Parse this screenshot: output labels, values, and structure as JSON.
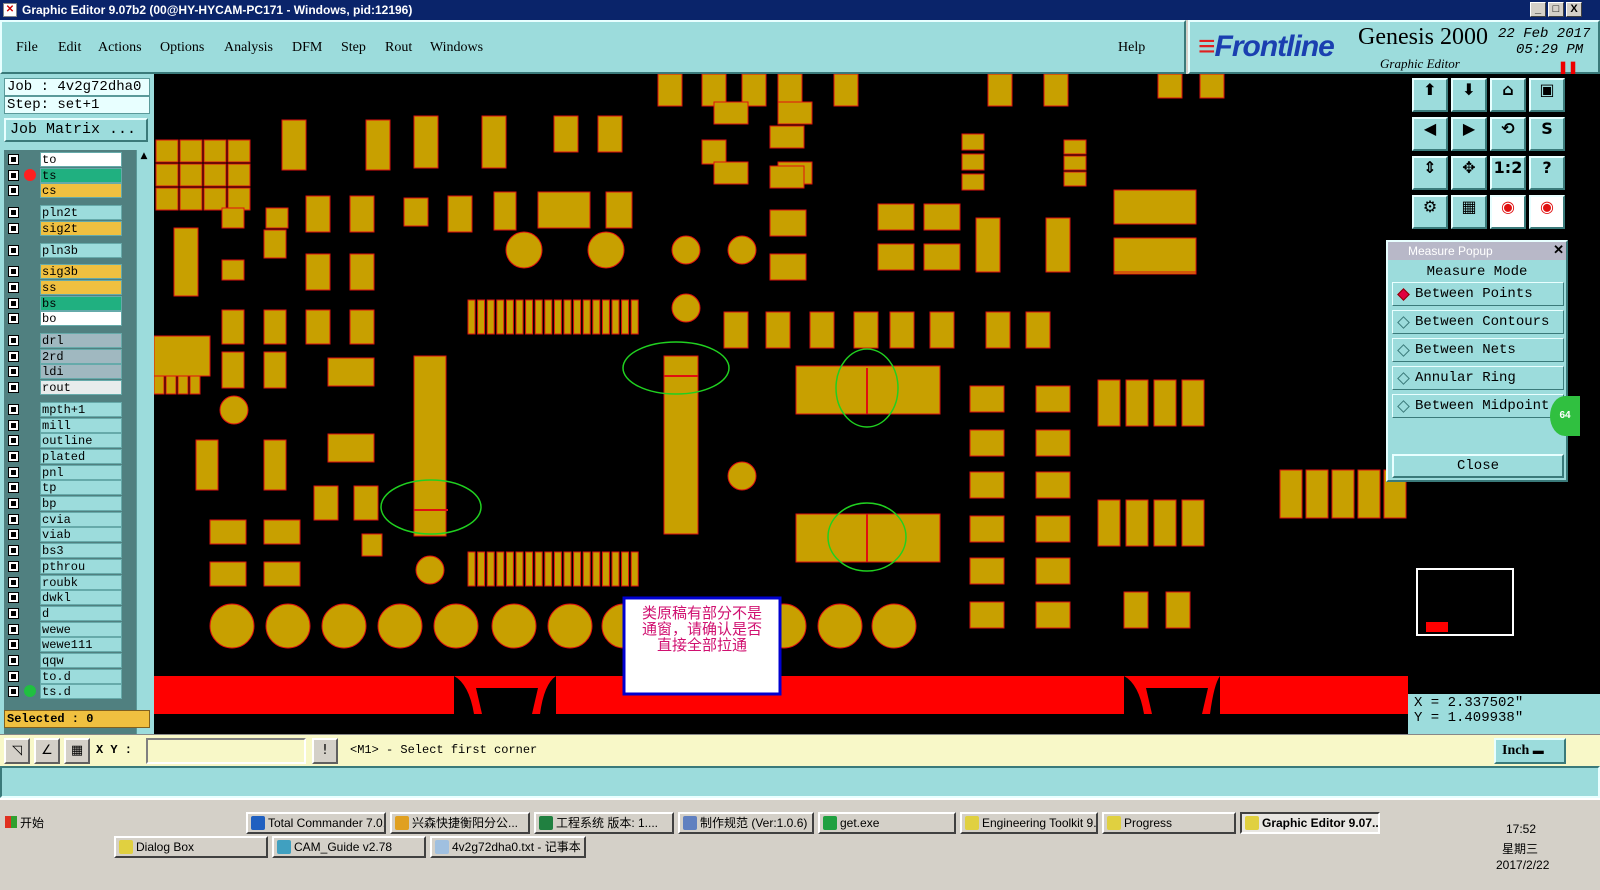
{
  "window": {
    "title": "Graphic Editor 9.07b2 (00@HY-HYCAM-PC171 - Windows, pid:12196)",
    "controls": [
      "_",
      "□",
      "X"
    ]
  },
  "menu": [
    "File",
    "Edit",
    "Actions",
    "Options",
    "Analysis",
    "DFM",
    "Step",
    "Rout",
    "Windows"
  ],
  "help_label": "Help",
  "brand": {
    "logo": "Frontline",
    "product": "Genesis 2000",
    "subtitle": "Graphic Editor",
    "date": "22 Feb 2017",
    "time": "05:29 PM",
    "pause_icon": "pause-icon"
  },
  "job": "Job : 4v2g72dha0",
  "step": "Step: set+1",
  "job_matrix": "Job Matrix ...",
  "layers": [
    {
      "name": "to",
      "color": "#ffffff",
      "dot": ""
    },
    {
      "name": "ts",
      "color": "#20b080",
      "dot": "#ff2020"
    },
    {
      "name": "cs",
      "color": "#f0c040",
      "dot": ""
    },
    {
      "name": "pln2t",
      "color": "#9cdcdc",
      "dot": ""
    },
    {
      "name": "sig2t",
      "color": "#f0c040",
      "dot": ""
    },
    {
      "name": "pln3b",
      "color": "#9cdcdc",
      "dot": ""
    },
    {
      "name": "sig3b",
      "color": "#f0c040",
      "dot": ""
    },
    {
      "name": "ss",
      "color": "#f0c040",
      "dot": ""
    },
    {
      "name": "bs",
      "color": "#20b080",
      "dot": ""
    },
    {
      "name": "bo",
      "color": "#ffffff",
      "dot": ""
    },
    {
      "name": "drl",
      "color": "#a0b8c0",
      "dot": ""
    },
    {
      "name": "2rd",
      "color": "#a0b8c0",
      "dot": ""
    },
    {
      "name": "ldi",
      "color": "#a0b8c0",
      "dot": ""
    },
    {
      "name": "rout",
      "color": "#e8ecec",
      "dot": ""
    },
    {
      "name": "mpth+1",
      "color": "#9cdcdc",
      "dot": ""
    },
    {
      "name": "mill",
      "color": "#9cdcdc",
      "dot": ""
    },
    {
      "name": "outline",
      "color": "#9cdcdc",
      "dot": ""
    },
    {
      "name": "plated",
      "color": "#9cdcdc",
      "dot": ""
    },
    {
      "name": "pnl",
      "color": "#9cdcdc",
      "dot": ""
    },
    {
      "name": "tp",
      "color": "#9cdcdc",
      "dot": ""
    },
    {
      "name": "bp",
      "color": "#9cdcdc",
      "dot": ""
    },
    {
      "name": "cvia",
      "color": "#9cdcdc",
      "dot": ""
    },
    {
      "name": "viab",
      "color": "#9cdcdc",
      "dot": ""
    },
    {
      "name": "bs3",
      "color": "#9cdcdc",
      "dot": ""
    },
    {
      "name": "pthrou",
      "color": "#9cdcdc",
      "dot": ""
    },
    {
      "name": "roubk",
      "color": "#9cdcdc",
      "dot": ""
    },
    {
      "name": "dwkl",
      "color": "#9cdcdc",
      "dot": ""
    },
    {
      "name": "d",
      "color": "#9cdcdc",
      "dot": ""
    },
    {
      "name": "wewe",
      "color": "#9cdcdc",
      "dot": ""
    },
    {
      "name": "wewe111",
      "color": "#9cdcdc",
      "dot": ""
    },
    {
      "name": "qqw",
      "color": "#9cdcdc",
      "dot": ""
    },
    {
      "name": "to.d",
      "color": "#9cdcdc",
      "dot": ""
    },
    {
      "name": "ts.d",
      "color": "#9cdcdc",
      "dot": "#20c040"
    }
  ],
  "selected": "Selected : 0",
  "annotation": {
    "line1": "类原稿有部分不是",
    "line2": "通窗，请确认是否",
    "line3": "直接全部拉通"
  },
  "toolbar_icons": [
    "zoom-home-icon",
    "zoom-in-icon",
    "home-icon",
    "window-icon",
    "pan-left-icon",
    "pan-right-icon",
    "undo-icon",
    "redraw-icon",
    "fit-icon",
    "center-icon",
    "scale-1-2-icon",
    "help-icon",
    "measure-tools-icon",
    "grid-icon",
    "layer-compare-icon",
    "layer-display-icon"
  ],
  "toolbar_glyphs": [
    "⬆",
    "⬇",
    "⌂",
    "▣",
    "◀",
    "▶",
    "⟲",
    "S",
    "⇕",
    "✥",
    "1:2",
    "?",
    "⚙",
    "▦",
    "◉",
    "◉"
  ],
  "measure_popup": {
    "title": "Measure Popup",
    "mode_label": "Measure Mode",
    "options": [
      "Between Points",
      "Between Contours",
      "Between Nets",
      "Annular Ring",
      "Between Midpoint"
    ],
    "selected_option": "Between Points",
    "badge": "64",
    "close_label": "Close"
  },
  "coords": {
    "x": "X = 2.337502\"",
    "y": "Y = 1.409938\""
  },
  "command": {
    "xy_label": "X Y :",
    "input_value": "",
    "prompt": "<M1> - Select first corner",
    "units": "Inch",
    "units_icon": "dropdown-icon"
  },
  "taskbar": {
    "start": "开始",
    "tasks_row1": [
      {
        "label": "Total Commander 7.0...",
        "icon": "#2060c0"
      },
      {
        "label": "兴森快捷衡阳分公...",
        "icon": "#e0a020"
      },
      {
        "label": "工程系统  版本: 1....",
        "icon": "#208040"
      },
      {
        "label": "制作规范 (Ver:1.0.6)",
        "icon": "#6080c0"
      },
      {
        "label": "get.exe",
        "icon": "#20a040"
      },
      {
        "label": "Engineering Toolkit 9....",
        "icon": "#e0d040"
      },
      {
        "label": "Progress",
        "icon": "#e0d040"
      },
      {
        "label": "Graphic Editor 9.07...",
        "icon": "#e0d040",
        "active": true
      }
    ],
    "tasks_row2": [
      {
        "label": "Dialog Box",
        "icon": "#e0d040"
      },
      {
        "label": "CAM_Guide v2.78",
        "icon": "#40a0c0"
      },
      {
        "label": "4v2g72dha0.txt - 记事本",
        "icon": "#a0c0e0"
      }
    ],
    "clock_time": "17:52",
    "clock_day": "星期三",
    "clock_date": "2017/2/22"
  }
}
